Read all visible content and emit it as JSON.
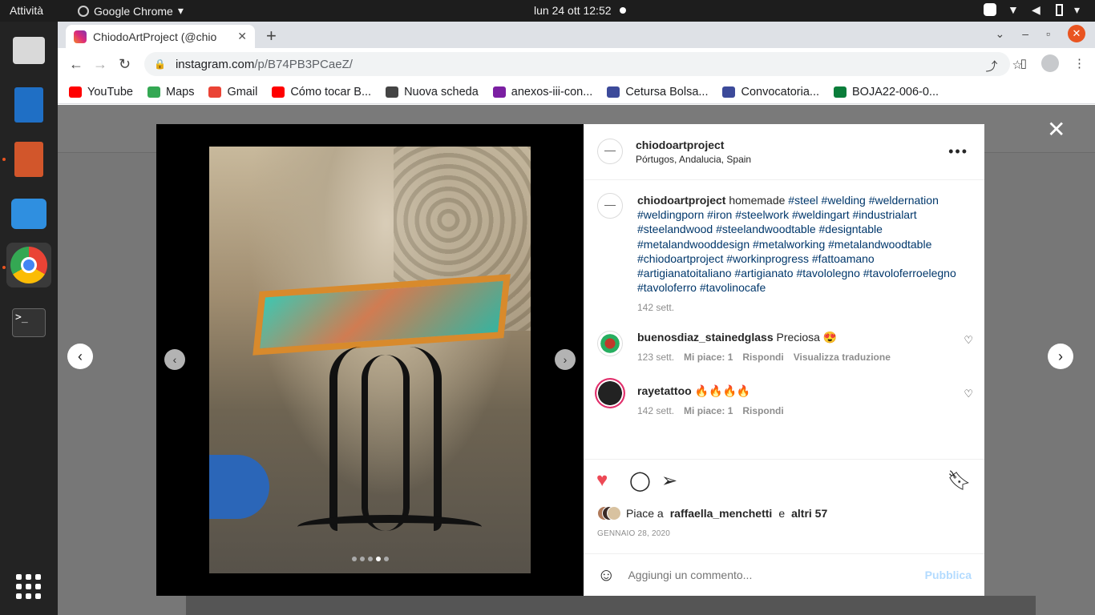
{
  "system": {
    "activities": "Attività",
    "app_name": "Google Chrome",
    "clock": "lun 24 ott  12:52"
  },
  "browser": {
    "tab_title": "ChiodoArtProject (@chio",
    "url_host": "instagram.com",
    "url_path": "/p/B74PB3PCaeZ/",
    "bookmarks": [
      {
        "label": "YouTube",
        "color": "#ff0000"
      },
      {
        "label": "Maps",
        "color": "#34a853"
      },
      {
        "label": "Gmail",
        "color": "#ea4335"
      },
      {
        "label": "Cómo tocar B...",
        "color": "#ff0000"
      },
      {
        "label": "Nuova scheda",
        "color": "#444444"
      },
      {
        "label": "anexos-iii-con...",
        "color": "#7b1fa2"
      },
      {
        "label": "Cetursa Bolsa...",
        "color": "#3c4a9a"
      },
      {
        "label": "Convocatoria...",
        "color": "#3c4a9a"
      },
      {
        "label": "BOJA22-006-0...",
        "color": "#0a7d3a"
      }
    ]
  },
  "post": {
    "username": "chiodoartproject",
    "location": "Pórtugos, Andalucia, Spain",
    "caption_user": "chiodoartproject",
    "caption_word": "homemade",
    "caption_tags": "#steel #welding #weldernation #weldingporn #iron #steelwork #weldingart #industrialart #steelandwood #steelandwoodtable #designtable #metalandwooddesign #metalworking #metalandwoodtable #chiodoartproject #workinprogress #fattoamano #artigianatoitaliano #artigianato #tavololegno #tavoloferroelegno #tavoloferro #tavolinocafe",
    "caption_time": "142 sett.",
    "comments": [
      {
        "user": "buenosdiaz_stainedglass",
        "text": "Preciosa 😍",
        "time": "123 sett.",
        "likes": "Mi piace: 1",
        "reply": "Rispondi",
        "translate": "Visualizza traduzione"
      },
      {
        "user": "rayetattoo",
        "text": "🔥🔥🔥🔥",
        "time": "142 sett.",
        "likes": "Mi piace: 1",
        "reply": "Rispondi"
      }
    ],
    "likes_prefix": "Piace a",
    "likes_user": "raffaella_menchetti",
    "likes_and": "e",
    "likes_others": "altri 57",
    "date": "GENNAIO 28, 2020",
    "comment_placeholder": "Aggiungi un commento...",
    "publish_label": "Pubblica",
    "carousel_count": 5,
    "carousel_active": 4,
    "liked": true,
    "like_color": "#ed4956"
  }
}
